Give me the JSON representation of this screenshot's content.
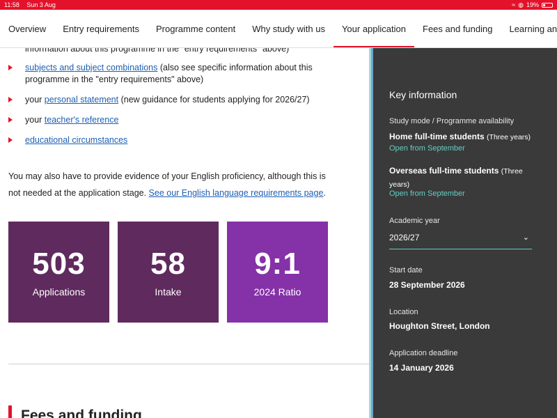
{
  "status": {
    "time": "11:58",
    "date": "Sun 3 Aug",
    "battery": "19%"
  },
  "nav": {
    "tabs": [
      "Overview",
      "Entry requirements",
      "Programme content",
      "Why study with us",
      "Your application",
      "Fees and funding",
      "Learning and assessm"
    ]
  },
  "main": {
    "cut_line": "information about this programme in the \"entry requirements\" above)",
    "items": [
      {
        "link": "subjects and subject combinations",
        "text": " (also see specific information about this programme in the \"entry requirements\" above)"
      },
      {
        "prefix": "your ",
        "link": "personal statement",
        "text": " (new guidance for students applying for 2026/27)"
      },
      {
        "prefix": "your ",
        "link": "teacher's reference",
        "text": ""
      },
      {
        "link": "educational circumstances",
        "text": ""
      }
    ],
    "para_text": "You may also have to provide evidence of your English proficiency, although this is not needed at the application stage. ",
    "para_link": "See our English language requirements page",
    "para_end": ".",
    "stats": [
      {
        "num": "503",
        "label": "Applications",
        "color": "#5f2a5e"
      },
      {
        "num": "58",
        "label": "Intake",
        "color": "#5f2a5e"
      },
      {
        "num": "9:1",
        "label": "2024 Ratio",
        "color": "#8531a8"
      }
    ],
    "fees_title": "Fees and funding"
  },
  "panel": {
    "title": "Key information",
    "study_label": "Study mode / Programme availability",
    "home_title": "Home full-time students",
    "home_years": "(Three years)",
    "home_open": "Open from September",
    "overseas_title": "Overseas full-time students",
    "overseas_years": "(Three years)",
    "overseas_open": "Open from September",
    "year_label": "Academic year",
    "year_value": "2026/27",
    "start_label": "Start date",
    "start_value": "28 September 2026",
    "location_label": "Location",
    "location_value": "Houghton Street, London",
    "deadline_label": "Application deadline",
    "deadline_value": "14 January 2026"
  }
}
